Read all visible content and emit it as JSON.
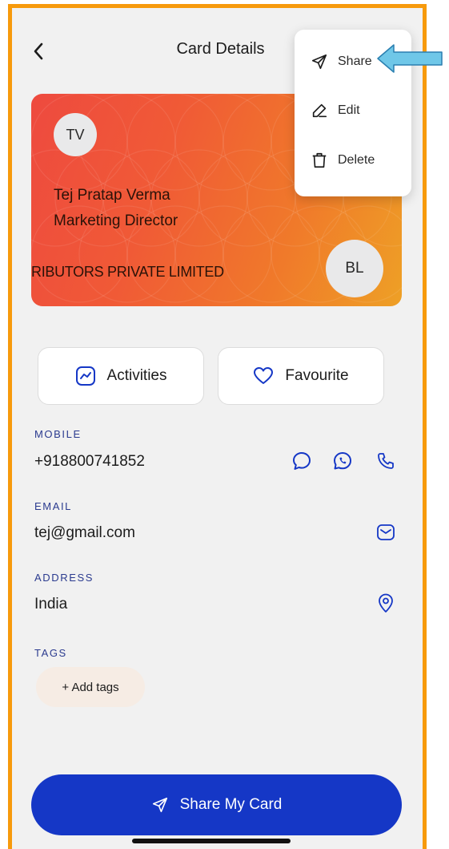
{
  "header": {
    "title": "Card Details"
  },
  "menu": {
    "items": [
      {
        "label": "Share",
        "icon": "send-icon"
      },
      {
        "label": "Edit",
        "icon": "pencil-icon"
      },
      {
        "label": "Delete",
        "icon": "trash-icon"
      }
    ]
  },
  "card": {
    "initials": "TV",
    "name": "Tej Pratap Verma",
    "role": "Marketing Director",
    "company": "RIBUTORS PRIVATE LIMITED",
    "company_initials": "BL",
    "gradient": [
      "#ee4a3f",
      "#eea026"
    ]
  },
  "actions": {
    "activities_label": "Activities",
    "favourite_label": "Favourite"
  },
  "fields": {
    "mobile_label": "MOBILE",
    "mobile_value": "+918800741852",
    "email_label": "EMAIL",
    "email_value": "tej@gmail.com",
    "address_label": "ADDRESS",
    "address_value": "India",
    "tags_label": "TAGS",
    "add_tags_label": "+ Add tags"
  },
  "footer": {
    "share_my_card_label": "Share My Card"
  },
  "colors": {
    "accent_blue": "#1537c6",
    "icon_blue": "#2b3b8f",
    "frame_orange": "#f79a0c",
    "arrow_blue": "#6fc7e8"
  }
}
